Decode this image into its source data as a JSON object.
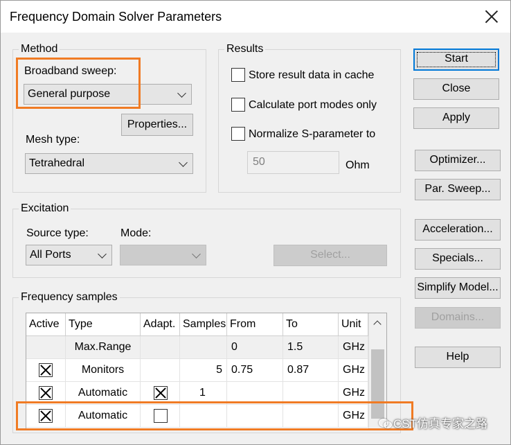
{
  "window": {
    "title": "Frequency Domain Solver Parameters"
  },
  "method": {
    "group_label": "Method",
    "broadband_label": "Broadband sweep:",
    "broadband_value": "General purpose",
    "properties_button": "Properties...",
    "mesh_label": "Mesh type:",
    "mesh_value": "Tetrahedral"
  },
  "results": {
    "group_label": "Results",
    "store_cache_label": "Store result data in cache",
    "port_modes_label": "Calculate port modes only",
    "normalize_label": "Normalize S-parameter to",
    "normalize_value": "50",
    "normalize_unit": "Ohm"
  },
  "excitation": {
    "group_label": "Excitation",
    "source_label": "Source type:",
    "source_value": "All Ports",
    "mode_label": "Mode:",
    "mode_value": "",
    "select_button": "Select..."
  },
  "freq_samples": {
    "group_label": "Frequency samples",
    "columns": [
      "Active",
      "Type",
      "Adapt.",
      "Samples",
      "From",
      "To",
      "Unit"
    ],
    "rows": [
      {
        "active": "",
        "type": "Max.Range",
        "adapt": "",
        "samples": "",
        "from": "0",
        "to": "1.5",
        "unit": "GHz"
      },
      {
        "active": "checked",
        "type": "Monitors",
        "adapt": "",
        "samples": "5",
        "from": "0.75",
        "to": "0.87",
        "unit": "GHz"
      },
      {
        "active": "checked",
        "type": "Automatic",
        "adapt": "checked",
        "samples": "1",
        "from": "",
        "to": "",
        "unit": "GHz"
      },
      {
        "active": "checked",
        "type": "Automatic",
        "adapt": "unchecked",
        "samples": "",
        "from": "",
        "to": "",
        "unit": "GHz"
      }
    ]
  },
  "side_buttons": {
    "start": "Start",
    "close": "Close",
    "apply": "Apply",
    "optimizer": "Optimizer...",
    "par_sweep": "Par. Sweep...",
    "acceleration": "Acceleration...",
    "specials": "Specials...",
    "simplify_model": "Simplify Model...",
    "domains": "Domains...",
    "help": "Help"
  },
  "watermark": {
    "text": "CST仿真专家之路"
  },
  "colors": {
    "highlight": "#f07b24",
    "focus": "#0078d7"
  }
}
